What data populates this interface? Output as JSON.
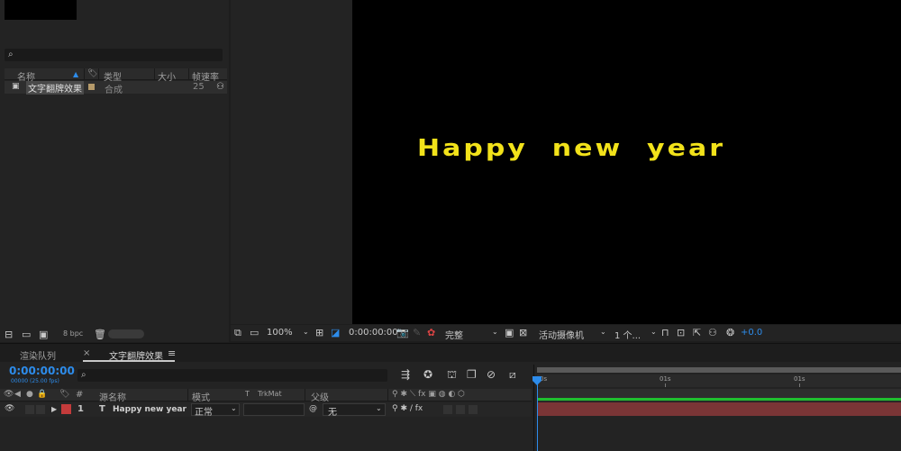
{
  "project": {
    "columns": {
      "name": "名称",
      "type": "类型",
      "size": "大小",
      "fps": "帧速率"
    },
    "item": {
      "name": "文字翻牌效果",
      "type": "合成",
      "fps": "25"
    },
    "bpc": "8 bpc"
  },
  "viewer": {
    "text": "Happy  new  year",
    "text_color": "#f2e21a",
    "zoom": "100%",
    "timecode": "0:00:00:00",
    "resolution": "完整",
    "camera": "活动摄像机",
    "views": "1 个...",
    "exposure": "+0.0"
  },
  "timeline": {
    "tabs": [
      "渲染队列",
      "文字翻牌效果"
    ],
    "close_glyph": "×",
    "menu_glyph": "≡",
    "timecode": "0:00:00:00",
    "frames": "00000 (25.00 fps)",
    "columns": {
      "hash": "#",
      "source": "源名称",
      "mode": "模式",
      "t": "T",
      "trkmat": "TrkMat",
      "parent": "父级"
    },
    "layer": {
      "index": "1",
      "type_glyph": "T",
      "name": "Happy new year",
      "mode": "正常",
      "parent": "无"
    },
    "ruler": {
      "start": "0s",
      "mid": "01s",
      "end": "01s"
    },
    "accent": "#2d8ceb",
    "label_color": "#c33b3b"
  }
}
